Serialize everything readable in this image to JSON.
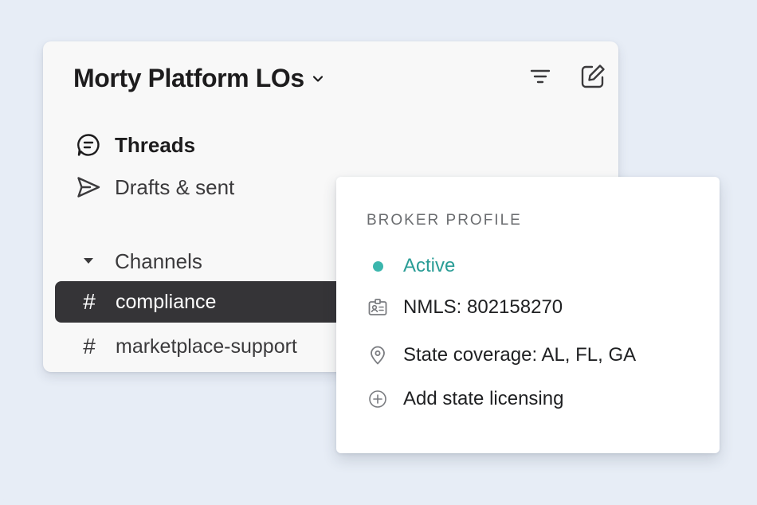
{
  "workspace": {
    "name": "Morty Platform LOs"
  },
  "nav": {
    "threads": "Threads",
    "drafts": "Drafts & sent",
    "channels_section": "Channels"
  },
  "channels": [
    {
      "hash": "#",
      "name": "compliance",
      "active": true
    },
    {
      "hash": "#",
      "name": "marketplace-support",
      "active": false
    }
  ],
  "profile": {
    "heading": "BROKER PROFILE",
    "status": "Active",
    "nmls": "NMLS: 802158270",
    "coverage": "State coverage: AL, FL, GA",
    "add_licensing": "Add state licensing"
  },
  "icons": {
    "workspace_menu": "chevron-down-icon",
    "filter": "filter-icon",
    "compose": "compose-icon",
    "threads": "threads-icon",
    "drafts": "send-icon",
    "channels_toggle": "caret-down-icon",
    "status": "status-dot-icon",
    "nmls": "id-card-icon",
    "coverage": "location-pin-icon",
    "add": "plus-circle-icon"
  },
  "colors": {
    "background": "#e7edf6",
    "active_channel_bg": "#353437",
    "status_green": "#2a9d96",
    "text_primary": "#1d1c1d"
  }
}
